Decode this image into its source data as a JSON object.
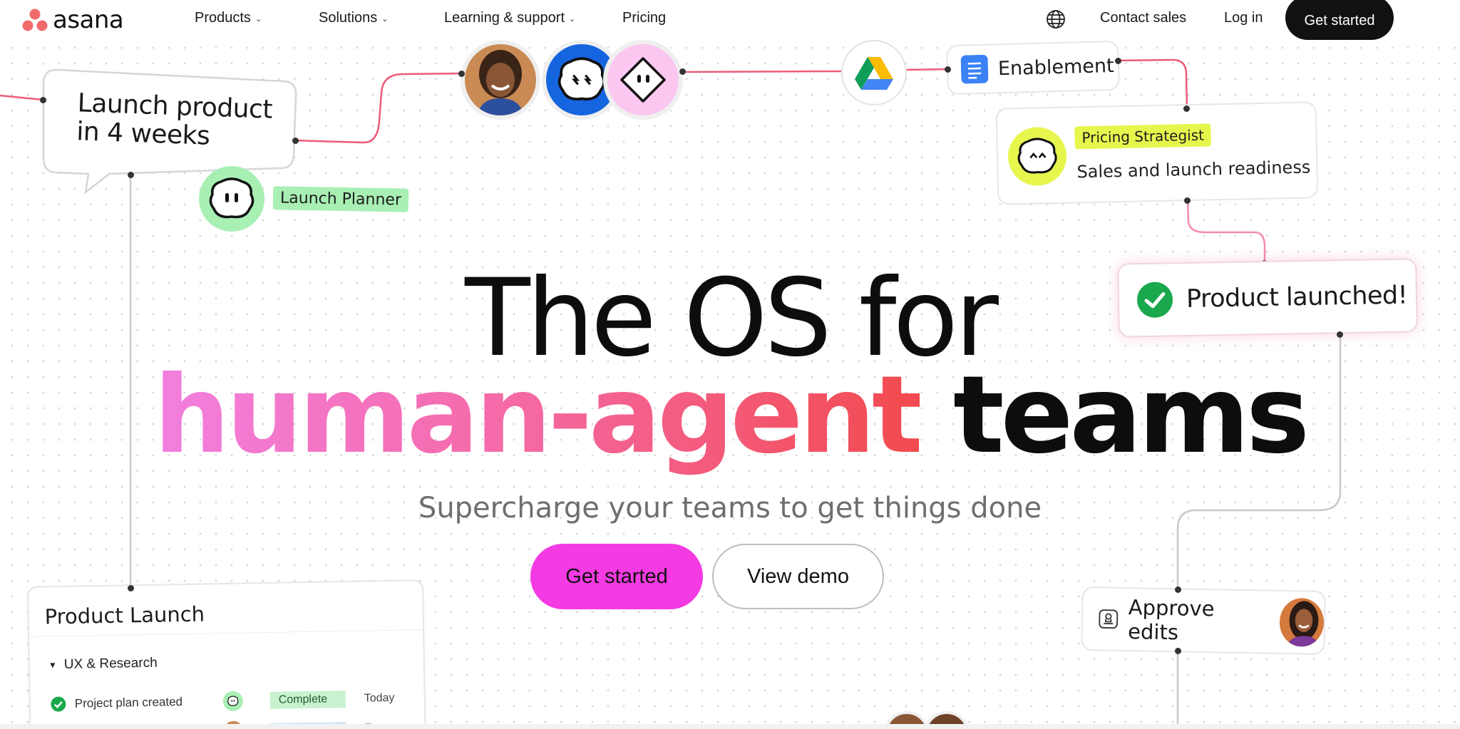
{
  "nav": {
    "logo_text": "asana",
    "items": [
      {
        "label": "Products",
        "dropdown": true
      },
      {
        "label": "Solutions",
        "dropdown": true
      },
      {
        "label": "Learning & support",
        "dropdown": true
      },
      {
        "label": "Pricing",
        "dropdown": false
      }
    ],
    "globe_icon": "globe-icon",
    "contact_sales": "Contact sales",
    "log_in": "Log in",
    "get_started": "Get started"
  },
  "hero": {
    "line1": "The OS for",
    "line2_gradient": "human-agent",
    "line2_rest": "teams",
    "subtitle": "Supercharge your teams to get things done",
    "primary_cta": "Get started",
    "secondary_cta": "View demo"
  },
  "flow": {
    "launch_bubble": {
      "line1": "Launch product",
      "line2": "in 4 weeks"
    },
    "launch_planner": "Launch Planner",
    "enablement": "Enablement",
    "pricing_strategist": {
      "badge": "Pricing Strategist",
      "task": "Sales and launch readiness"
    },
    "product_launched": "Product launched!",
    "approve_edits": "Approve edits"
  },
  "project_card": {
    "title": "Product Launch",
    "section": "UX & Research",
    "rows": [
      {
        "task": "Project plan created",
        "status": "Complete",
        "due": "Today"
      },
      {
        "task": "",
        "status": "",
        "due": "Tomorrow"
      }
    ]
  },
  "colors": {
    "brand_coral": "#f06a6a",
    "cta_magenta": "#f43ae3",
    "gradient_start": "#f27fe0",
    "gradient_end": "#f24a4e",
    "planner_green": "#a8efb4",
    "strategist_yellow": "#e6f64d",
    "check_green": "#1aa84c",
    "wire_pink": "#ef5b7a"
  }
}
